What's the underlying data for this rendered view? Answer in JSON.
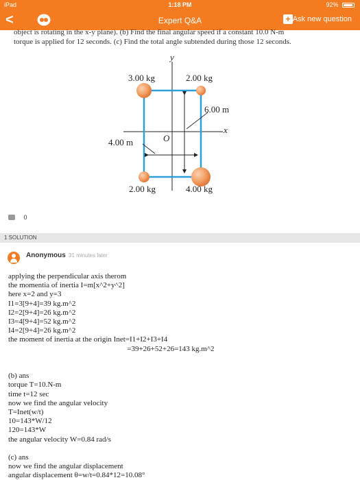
{
  "status_bar": {
    "device": "iPad",
    "time": "1:18 PM",
    "battery": "92%"
  },
  "nav": {
    "back_label": "<",
    "title": "Expert Q&A",
    "ask_label": "Ask new question",
    "ask_icon": "+"
  },
  "question": {
    "line1": "object is rotating in the x-y plane). (b) Find the final angular speed if a constant 10.0 N-m",
    "line2": "torque is applied for 12 seconds. (c) Find the total angle subtended during those 12 seconds."
  },
  "figure": {
    "y_axis": "y",
    "x_axis": "x",
    "origin": "O",
    "mass_top_left": "3.00 kg",
    "mass_top_right": "2.00 kg",
    "mass_bottom_left": "2.00 kg",
    "mass_bottom_right": "4.00 kg",
    "height_label": "6.00 m",
    "width_label": "4.00 m",
    "colors": {
      "frame": "#2b9fd8",
      "mass": "#f4a066",
      "mass_dark": "#e07a3a"
    }
  },
  "comments": {
    "count": "0"
  },
  "solution_header": "1 SOLUTION",
  "answer": {
    "author": "Anonymous",
    "timestamp": "31 minutes later",
    "lines": [
      "applying the perpendicular axis therom",
      "the momentia of inertia I=m[x^2+y^2]",
      "here x=2 and y=3",
      "I1=3[9+4]=39 kg.m^2",
      "I2=2[9+4]=26 kg.m^2",
      "I3=4[9+4]=52 kg.m^2",
      "I4=2[9+4]=26 kg.m^2",
      "the moment of inertia at the origin Inet=I1+I2+I3+I4",
      "                                                               =39+26+52+26=143 kg.m^2",
      "",
      "",
      "(b) ans",
      "torque T=10.N-m",
      "time t=12 sec",
      "now we find the angular velocity",
      "T=Inet(w/t)",
      "10=143*W/12",
      "120=143*W",
      "the angular velocity W=0.84 rad/s",
      "",
      "(c) ans",
      "now we find the angular displacement",
      "angular displacement θ=w/t=0.84*12=10.08°"
    ]
  }
}
